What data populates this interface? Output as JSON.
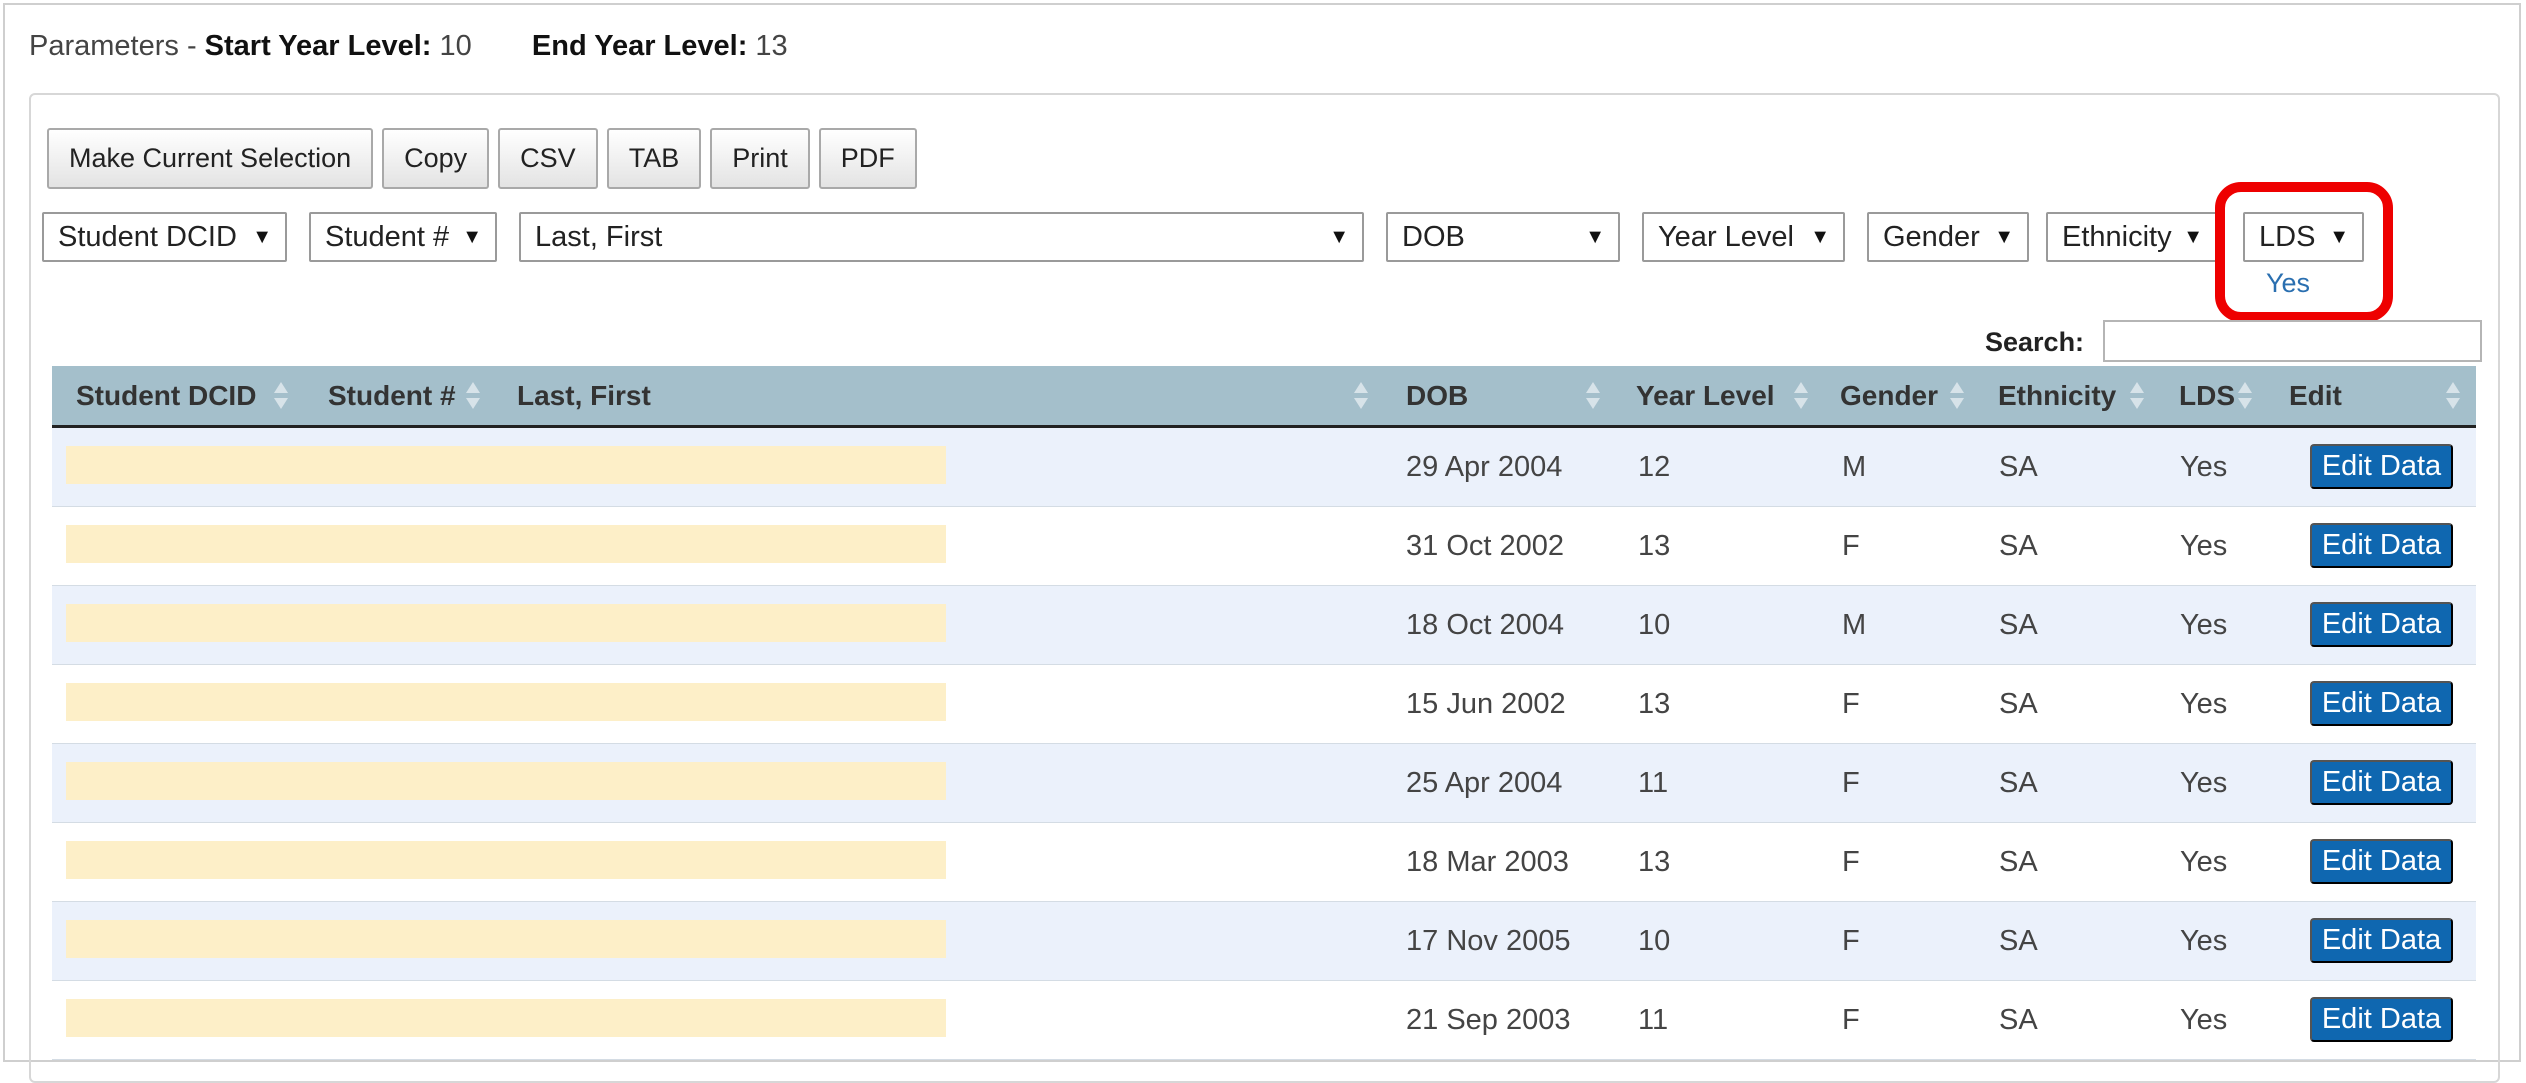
{
  "parameters": {
    "prefix": "Parameters -",
    "start_label": "Start Year Level:",
    "start_value": "10",
    "end_label": "End Year Level:",
    "end_value": "13"
  },
  "toolbar": {
    "buttons": [
      "Make Current Selection",
      "Copy",
      "CSV",
      "TAB",
      "Print",
      "PDF"
    ]
  },
  "filters": [
    {
      "label": "Student DCID"
    },
    {
      "label": "Student #"
    },
    {
      "label": "Last, First"
    },
    {
      "label": "DOB"
    },
    {
      "label": "Year Level"
    },
    {
      "label": "Gender"
    },
    {
      "label": "Ethnicity"
    },
    {
      "label": "LDS",
      "selected_value": "Yes"
    }
  ],
  "highlight_color": "#ee0000",
  "search": {
    "label": "Search:",
    "value": ""
  },
  "table": {
    "headers": [
      "Student DCID",
      "Student #",
      "Last, First",
      "DOB",
      "Year Level",
      "Gender",
      "Ethnicity",
      "LDS",
      "Edit"
    ],
    "rows": [
      {
        "dob": "29 Apr 2004",
        "year": "12",
        "gender": "M",
        "ethnicity": "SA",
        "lds": "Yes",
        "action": "Edit Data"
      },
      {
        "dob": "31 Oct 2002",
        "year": "13",
        "gender": "F",
        "ethnicity": "SA",
        "lds": "Yes",
        "action": "Edit Data"
      },
      {
        "dob": "18 Oct 2004",
        "year": "10",
        "gender": "M",
        "ethnicity": "SA",
        "lds": "Yes",
        "action": "Edit Data"
      },
      {
        "dob": "15 Jun 2002",
        "year": "13",
        "gender": "F",
        "ethnicity": "SA",
        "lds": "Yes",
        "action": "Edit Data"
      },
      {
        "dob": "25 Apr 2004",
        "year": "11",
        "gender": "F",
        "ethnicity": "SA",
        "lds": "Yes",
        "action": "Edit Data"
      },
      {
        "dob": "18 Mar 2003",
        "year": "13",
        "gender": "F",
        "ethnicity": "SA",
        "lds": "Yes",
        "action": "Edit Data"
      },
      {
        "dob": "17 Nov 2005",
        "year": "10",
        "gender": "F",
        "ethnicity": "SA",
        "lds": "Yes",
        "action": "Edit Data"
      },
      {
        "dob": "21 Sep 2003",
        "year": "11",
        "gender": "F",
        "ethnicity": "SA",
        "lds": "Yes",
        "action": "Edit Data"
      }
    ]
  }
}
